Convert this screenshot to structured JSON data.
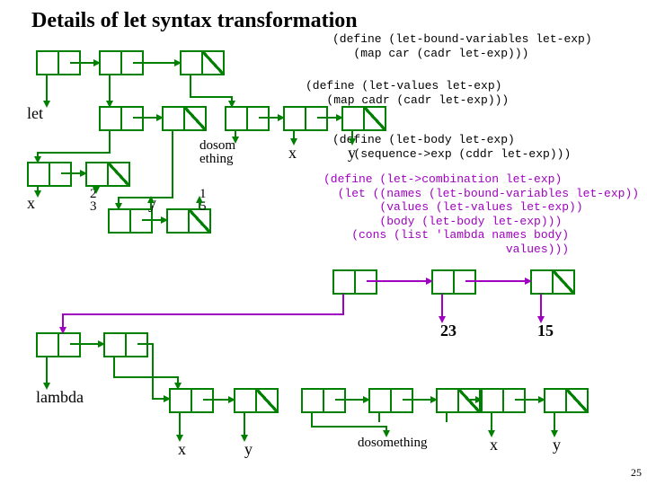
{
  "title": "Details of let syntax transformation",
  "code": {
    "def_bound_vars": "(define (let-bound-variables let-exp)\n   (map car (cadr let-exp)))",
    "def_values": "(define (let-values let-exp)\n   (map cadr (cadr let-exp)))",
    "def_body": "(define (let-body let-exp)\n   (sequence->exp (cddr let-exp)))",
    "def_comb": "(define (let->combination let-exp)\n  (let ((names (let-bound-variables let-exp))\n        (values (let-values let-exp))\n        (body (let-body let-exp)))\n    (cons (list 'lambda names body)\n                          values)))"
  },
  "labels": {
    "let": "let",
    "dosomething_wrapped": "dosom\nething",
    "x": "x",
    "y": "y",
    "num23_small": "2\n3",
    "num15_small": "1\n5",
    "num23": "23",
    "num15": "15",
    "lambda": "lambda",
    "dosomething": "dosomething"
  },
  "page_number": "25"
}
